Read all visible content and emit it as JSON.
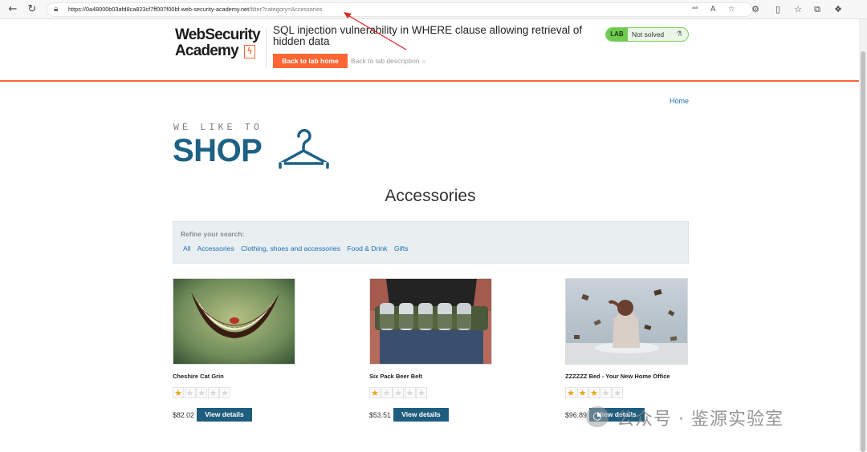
{
  "browser": {
    "url_main": "https://0a48000b03afd8ca823cf7ff007f00bf.web-security-academy.net",
    "url_path": "/filter?category=Accessories"
  },
  "lab": {
    "logo_line1": "WebSecurity",
    "logo_line2": "Academy",
    "title": "SQL injection vulnerability in WHERE clause allowing retrieval of hidden data",
    "back_home_label": "Back to lab home",
    "back_desc_label": "Back to lab description",
    "status_tag": "LAB",
    "status_text": "Not solved"
  },
  "nav": {
    "home_label": "Home"
  },
  "shop_logo": {
    "tagline": "WE LIKE TO",
    "word": "SHOP"
  },
  "category_title": "Accessories",
  "filter": {
    "label": "Refine your search:",
    "links": [
      "All",
      "Accessories",
      "Clothing, shoes and accessories",
      "Food & Drink",
      "Gifts"
    ]
  },
  "products": [
    {
      "name": "Cheshire Cat Grin",
      "rating": 1,
      "price": "$82.02",
      "button": "View details"
    },
    {
      "name": "Six Pack Beer Belt",
      "rating": 1,
      "price": "$53.51",
      "button": "View details"
    },
    {
      "name": "ZZZZZZ Bed - Your New Home Office",
      "rating": 3,
      "price": "$96.89",
      "button": "View details"
    }
  ],
  "watermark": {
    "text": "公众号 · 鉴源实验室"
  },
  "colors": {
    "accent": "#ff6633",
    "primary": "#1d6185",
    "link": "#1c6fb4",
    "status_green": "#6fca4d"
  },
  "icons": [
    "back-arrow-icon",
    "refresh-icon",
    "lock-icon",
    "read-aloud-icon",
    "text-size-icon",
    "favorite-icon",
    "extension-icon",
    "split-screen-icon",
    "favorites-bar-icon",
    "collections-icon",
    "copilot-icon",
    "flask-icon",
    "hanger-icon",
    "star-icon"
  ]
}
